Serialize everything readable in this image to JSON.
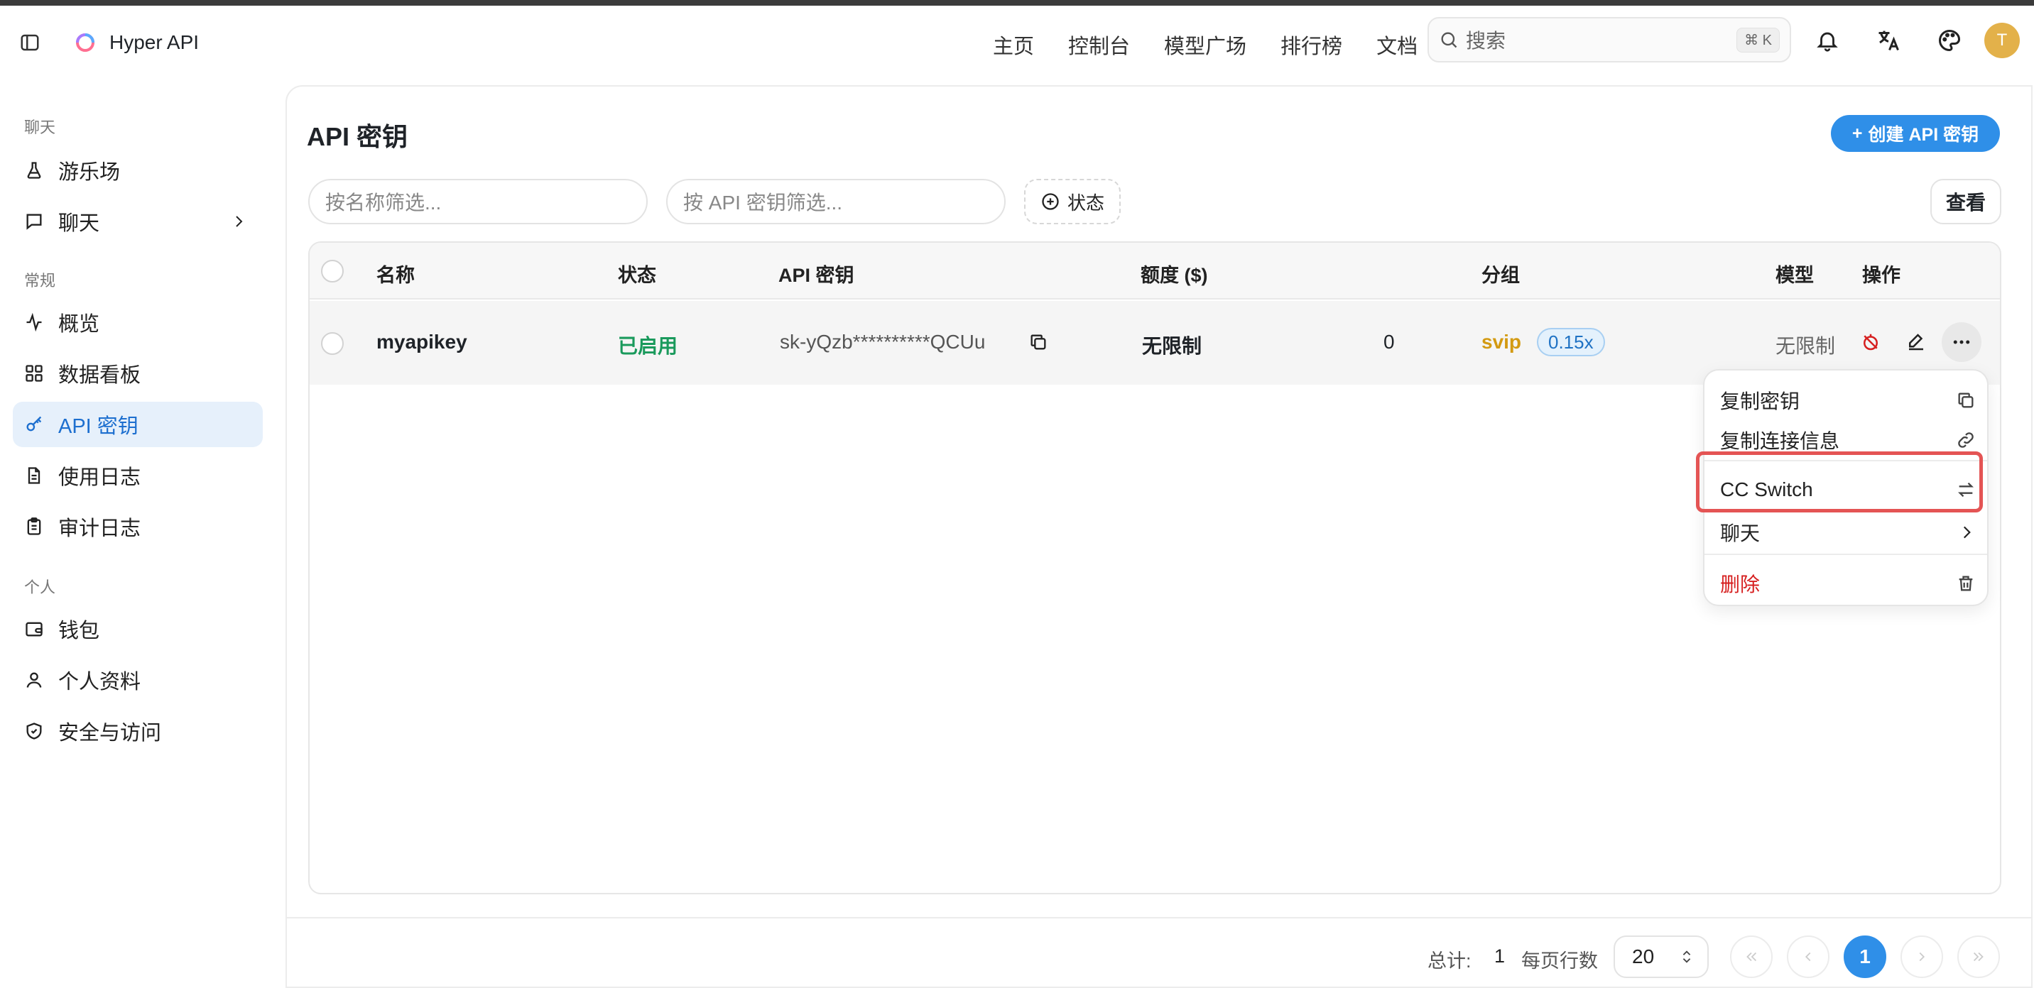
{
  "app": {
    "title": "Hyper API"
  },
  "nav": [
    "主页",
    "控制台",
    "模型广场",
    "排行榜",
    "文档"
  ],
  "search": {
    "placeholder": "搜索",
    "shortcut": "⌘ K"
  },
  "user": {
    "avatar_initial": "T"
  },
  "sidebar": {
    "sections": [
      {
        "label": "聊天",
        "items": [
          {
            "label": "游乐场",
            "icon": "flask-icon"
          },
          {
            "label": "聊天",
            "icon": "chat-icon"
          }
        ]
      },
      {
        "label": "常规",
        "items": [
          {
            "label": "概览",
            "icon": "activity-icon"
          },
          {
            "label": "数据看板",
            "icon": "dashboard-icon"
          },
          {
            "label": "API 密钥",
            "icon": "key-icon",
            "active": true
          },
          {
            "label": "使用日志",
            "icon": "document-icon"
          },
          {
            "label": "审计日志",
            "icon": "clipboard-icon"
          }
        ]
      },
      {
        "label": "个人",
        "items": [
          {
            "label": "钱包",
            "icon": "wallet-icon"
          },
          {
            "label": "个人资料",
            "icon": "user-icon"
          },
          {
            "label": "安全与访问",
            "icon": "shield-icon"
          }
        ]
      }
    ]
  },
  "page": {
    "title": "API 密钥",
    "create_label": "创建 API 密钥",
    "filter_name_placeholder": "按名称筛选...",
    "filter_key_placeholder": "按 API 密钥筛选...",
    "status_filter_label": "状态",
    "view_label": "查看"
  },
  "table": {
    "headers": {
      "name": "名称",
      "status": "状态",
      "key": "API 密钥",
      "quota": "额度 ($)",
      "group": "分组",
      "model": "模型",
      "actions": "操作"
    },
    "rows": [
      {
        "name": "myapikey",
        "status": "已启用",
        "key": "sk-yQzb**********QCUu",
        "quota": "无限制",
        "used": "0",
        "group": "svip",
        "ratio": "0.15x",
        "model": "无限制"
      }
    ]
  },
  "menu": {
    "items": [
      "复制密钥",
      "复制连接信息",
      "CC Switch",
      "聊天",
      "删除"
    ]
  },
  "pagination": {
    "total_label": "总计:",
    "total": "1",
    "rows_per_page_label": "每页行数",
    "rows_per_page": "20",
    "current_page": "1"
  },
  "colors": {
    "accent": "#2f8fe8",
    "status_enabled": "#1a9a5c",
    "group_svip": "#d39a12",
    "danger": "#d61f1f",
    "highlight": "#e45454"
  }
}
